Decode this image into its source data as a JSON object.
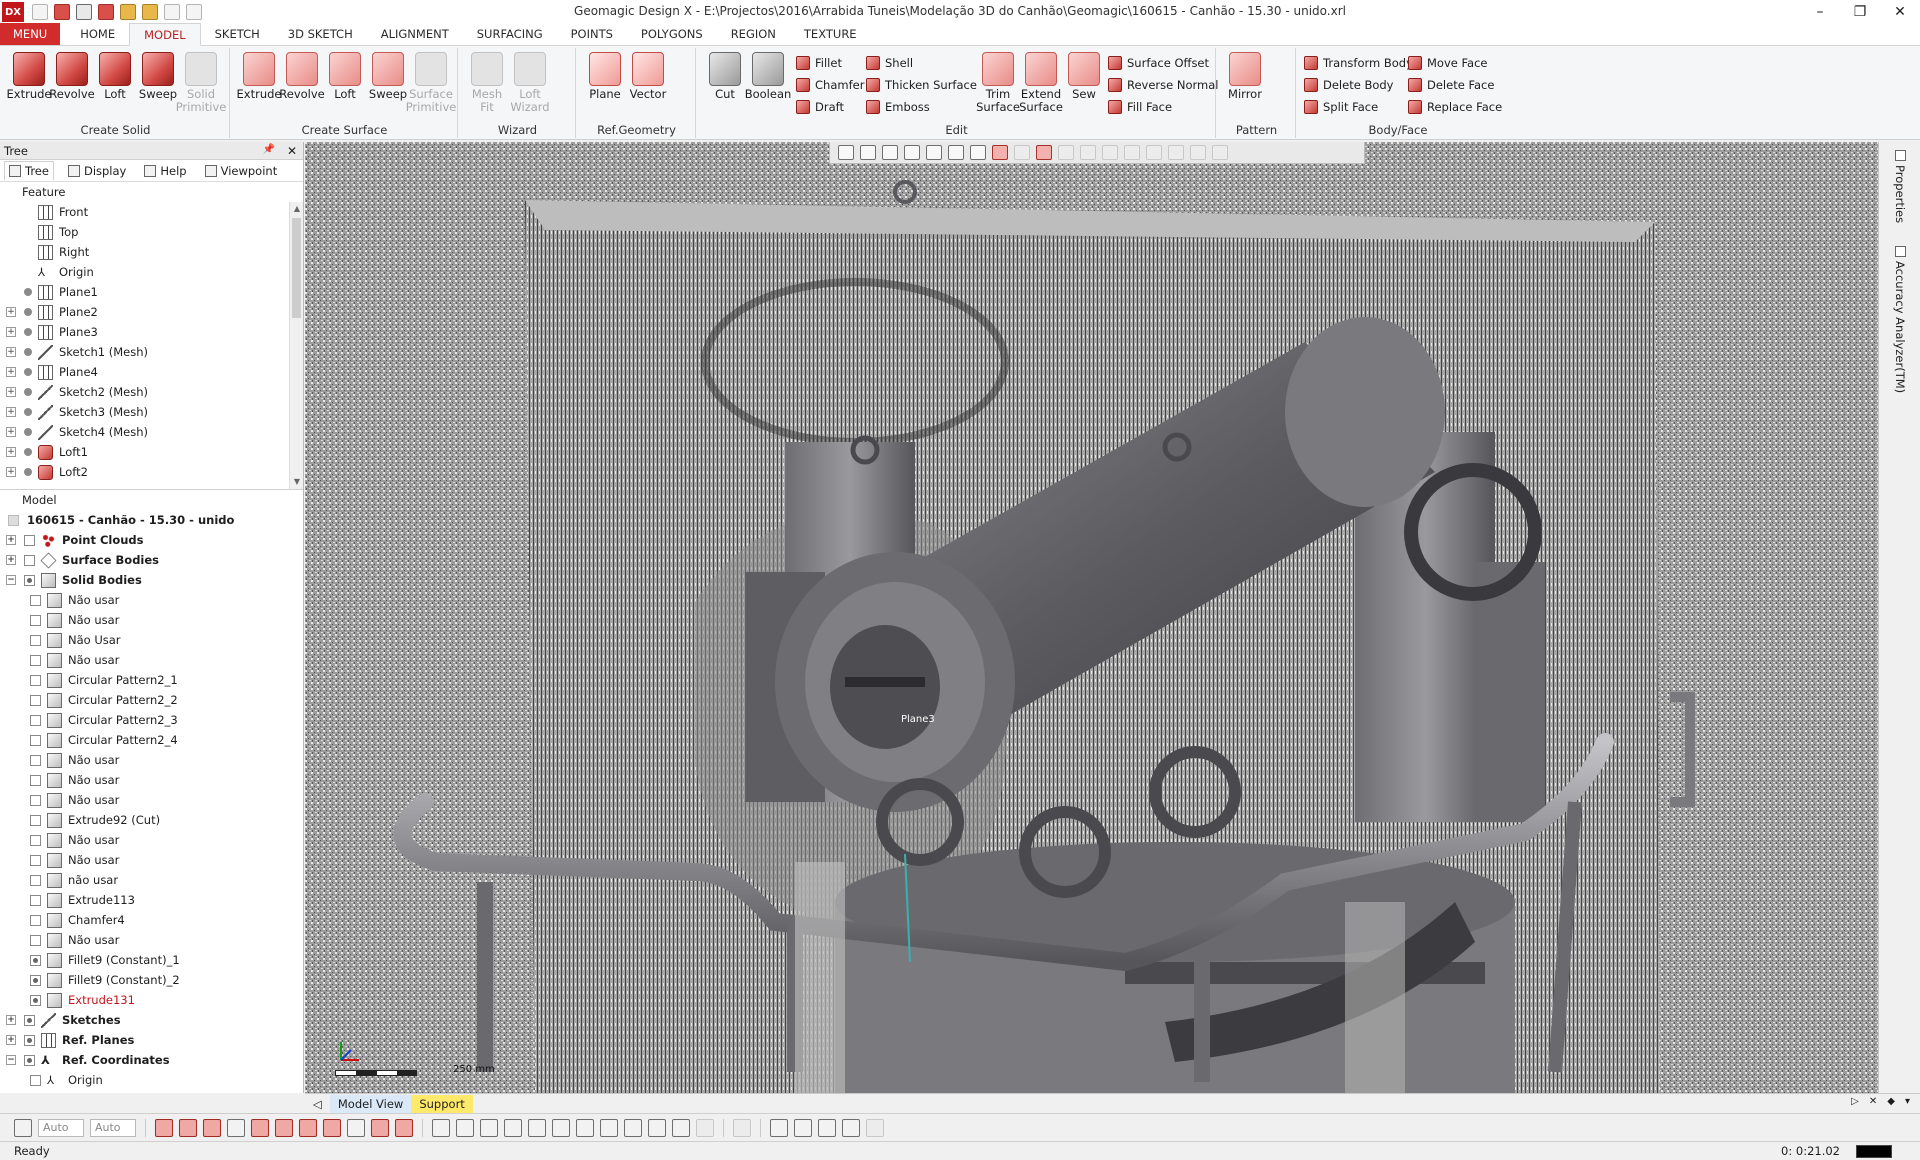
{
  "window": {
    "title": "Geomagic Design X - E:\\Projectos\\2016\\Arrabida Tuneis\\Modelação 3D do Canhão\\Geomagic\\160615 - Canhão - 15.30 - unido.xrl",
    "logo": "DX",
    "controls": {
      "minimize": "–",
      "restore": "❐",
      "close": "✕"
    }
  },
  "tabs": [
    {
      "label": "MENU"
    },
    {
      "label": "HOME"
    },
    {
      "label": "MODEL"
    },
    {
      "label": "SKETCH"
    },
    {
      "label": "3D SKETCH"
    },
    {
      "label": "ALIGNMENT"
    },
    {
      "label": "SURFACING"
    },
    {
      "label": "POINTS"
    },
    {
      "label": "POLYGONS"
    },
    {
      "label": "REGION"
    },
    {
      "label": "TEXTURE"
    }
  ],
  "ribbon": {
    "create_solid": {
      "label": "Create Solid",
      "extrude": "Extrude",
      "revolve": "Revolve",
      "loft": "Loft",
      "sweep": "Sweep",
      "solid_primitive": "Solid Primitive"
    },
    "create_surface": {
      "label": "Create Surface",
      "extrude": "Extrude",
      "revolve": "Revolve",
      "loft": "Loft",
      "sweep": "Sweep",
      "surface_primitive": "Surface Primitive"
    },
    "wizard": {
      "label": "Wizard",
      "mesh_fit": "Mesh Fit",
      "loft_wizard": "Loft Wizard"
    },
    "ref_geometry": {
      "label": "Ref.Geometry",
      "plane": "Plane",
      "vector": "Vector"
    },
    "edit": {
      "label": "Edit",
      "cut": "Cut",
      "boolean": "Boolean",
      "fillet": "Fillet",
      "chamfer": "Chamfer",
      "draft": "Draft",
      "shell": "Shell",
      "thicken_surface": "Thicken Surface",
      "emboss": "Emboss",
      "trim_surface": "Trim Surface",
      "extend_surface": "Extend Surface",
      "sew": "Sew",
      "surface_offset": "Surface Offset",
      "reverse_normal": "Reverse Normal",
      "fill_face": "Fill Face"
    },
    "pattern": {
      "label": "Pattern",
      "mirror": "Mirror"
    },
    "body_face": {
      "label": "Body/Face",
      "transform_body": "Transform Body",
      "delete_body": "Delete Body",
      "split_face": "Split Face",
      "move_face": "Move Face",
      "delete_face": "Delete Face",
      "replace_face": "Replace Face"
    }
  },
  "tree_panel": {
    "title": "Tree",
    "pin": "📌",
    "close": "✕",
    "tabs": [
      {
        "label": "Tree"
      },
      {
        "label": "Display"
      },
      {
        "label": "Help"
      },
      {
        "label": "Viewpoint"
      }
    ],
    "feature_title": "Feature",
    "features": [
      {
        "label": "Front",
        "icon": "plane"
      },
      {
        "label": "Top",
        "icon": "plane"
      },
      {
        "label": "Right",
        "icon": "plane"
      },
      {
        "label": "Origin",
        "icon": "origin"
      },
      {
        "label": "Plane1",
        "icon": "plane"
      },
      {
        "label": "Plane2",
        "icon": "plane"
      },
      {
        "label": "Plane3",
        "icon": "plane"
      },
      {
        "label": "Sketch1 (Mesh)",
        "icon": "sketch"
      },
      {
        "label": "Plane4",
        "icon": "plane"
      },
      {
        "label": "Sketch2 (Mesh)",
        "icon": "sketch"
      },
      {
        "label": "Sketch3 (Mesh)",
        "icon": "sketch"
      },
      {
        "label": "Sketch4 (Mesh)",
        "icon": "sketch"
      },
      {
        "label": "Loft1",
        "icon": "loft"
      },
      {
        "label": "Loft2",
        "icon": "loft"
      }
    ],
    "model_title": "Model",
    "model_root": "160615 - Canhão - 15.30 - unido",
    "groups": {
      "point_clouds": "Point Clouds",
      "surface_bodies": "Surface Bodies",
      "solid_bodies": "Solid Bodies",
      "sketches": "Sketches",
      "ref_planes": "Ref. Planes",
      "ref_coordinates": "Ref. Coordinates",
      "origin": "Origin"
    },
    "solid_bodies": [
      {
        "label": "Não usar"
      },
      {
        "label": "Não usar"
      },
      {
        "label": "Não Usar"
      },
      {
        "label": "Não usar"
      },
      {
        "label": "Circular Pattern2_1"
      },
      {
        "label": "Circular Pattern2_2"
      },
      {
        "label": "Circular Pattern2_3"
      },
      {
        "label": "Circular Pattern2_4"
      },
      {
        "label": "Não usar"
      },
      {
        "label": "Não usar"
      },
      {
        "label": "Não usar"
      },
      {
        "label": "Extrude92 (Cut)"
      },
      {
        "label": "Não usar"
      },
      {
        "label": "Não usar"
      },
      {
        "label": "não usar"
      },
      {
        "label": "Extrude113"
      },
      {
        "label": "Chamfer4"
      },
      {
        "label": "Não usar"
      },
      {
        "label": "Fillet9 (Constant)_1"
      },
      {
        "label": "Fillet9 (Constant)_2"
      },
      {
        "label": "Extrude131"
      }
    ]
  },
  "viewport": {
    "plane_label": "Plane3",
    "scale_label": "250 mm",
    "triad": {
      "x": "X",
      "y": "Y",
      "z": "Z"
    }
  },
  "right_panel": {
    "properties": "Properties",
    "accuracy": "Accuracy Analyzer(TM)"
  },
  "view_tabs": [
    {
      "label": "Model View"
    },
    {
      "label": "Support"
    }
  ],
  "bottom_toolbar": {
    "combo1": "Auto",
    "combo2": "Auto"
  },
  "status": {
    "text": "Ready",
    "time": "0: 0:21.02"
  }
}
